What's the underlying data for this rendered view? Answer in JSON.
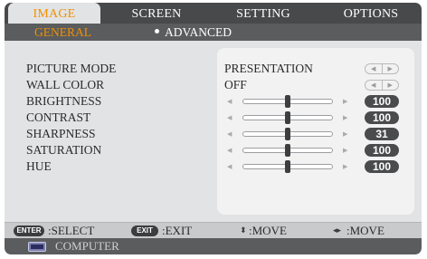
{
  "tabs": [
    "IMAGE",
    "SCREEN",
    "SETTING",
    "OPTIONS"
  ],
  "active_tab": "IMAGE",
  "subtabs": {
    "general": "GENERAL",
    "advanced": "ADVANCED"
  },
  "settings": [
    {
      "label": "PICTURE MODE",
      "value": "PRESENTATION",
      "control": "arrows"
    },
    {
      "label": "WALL COLOR",
      "value": "OFF",
      "control": "arrows"
    },
    {
      "label": "BRIGHTNESS",
      "value": "100",
      "level": 0.5,
      "control": "slider"
    },
    {
      "label": "CONTRAST",
      "value": "100",
      "level": 0.5,
      "control": "slider"
    },
    {
      "label": "SHARPNESS",
      "value": "31",
      "level": 0.5,
      "control": "slider"
    },
    {
      "label": "SATURATION",
      "value": "100",
      "level": 0.5,
      "control": "slider"
    },
    {
      "label": "HUE",
      "value": "100",
      "level": 0.5,
      "control": "slider"
    }
  ],
  "footer": {
    "enter_key": "ENTER",
    "select_label": ":SELECT",
    "exit_key": "EXIT",
    "exit_label": ":EXIT",
    "move_vertical_label": ":MOVE",
    "move_horizontal_label": ":MOVE"
  },
  "source": {
    "label": "COMPUTER",
    "icon": "monitor-icon"
  },
  "colors": {
    "accent": "#f09000",
    "bar_dark": "#48494b",
    "panel": "#e2e3e4"
  }
}
